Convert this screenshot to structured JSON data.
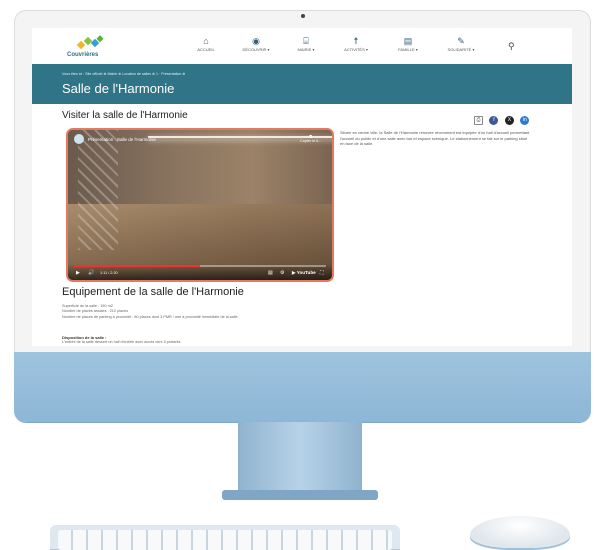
{
  "header": {
    "logo_text": "Couvrières",
    "nav": [
      {
        "icon": "home-icon",
        "glyph": "⌂",
        "label": "ACCUEIL"
      },
      {
        "icon": "eye-icon",
        "glyph": "◉",
        "label": "DÉCOUVRIR ▾"
      },
      {
        "icon": "town-hall-icon",
        "glyph": "⌸",
        "label": "MAIRIE ▾"
      },
      {
        "icon": "activity-icon",
        "glyph": "☨",
        "label": "ACTIVITÉS ▾"
      },
      {
        "icon": "family-icon",
        "glyph": "▤",
        "label": "FAMILLE ▾"
      },
      {
        "icon": "solidarity-icon",
        "glyph": "✎",
        "label": "SOLIDARITÉ ▾"
      }
    ]
  },
  "banner": {
    "breadcrumb": "Vous êtes ici : Site officiel ⊕ Mairie ⊕ Location de salles ⊕ 1 · Présentation ⊕",
    "title": "Salle de l'Harmonie"
  },
  "main": {
    "section_title": "Visiter la salle de l'Harmonie",
    "share": {
      "print": "⎙",
      "facebook": "f",
      "x": "X",
      "linkedin": "in",
      "colors": {
        "facebook": "#3b5998",
        "x": "#222222",
        "linkedin": "#2d7ad4"
      }
    },
    "video": {
      "title": "Présentation : Salle de l'Harmonie",
      "copy_label": "Copier le li...",
      "time": "1:11 / 2:20",
      "progress": 0.5
    },
    "side_text": "Située en centre ville, la Salle de l'Harmonie rénovée récemment est équipée d'un hall d'accueil permettant l'accueil du public et d'une salle avec bar et espace scénique. Le stationnement se fait sur le parking situé en face de la salle.",
    "equip_title": "Equipement de la salle de l'Harmonie",
    "specs": [
      "Superficie de la salle : 190 m2",
      "Nombre de places assises : 210 places",
      "Nombre de places de parking à proximité : 80 places dont 3 PMR / une à proximité immédiate de la salle."
    ],
    "dispo_title": "Disposition de la salle :",
    "dispo_text": "L'entrée de la salle dessert un hall d'entrée avec accès vers 3 portants"
  }
}
